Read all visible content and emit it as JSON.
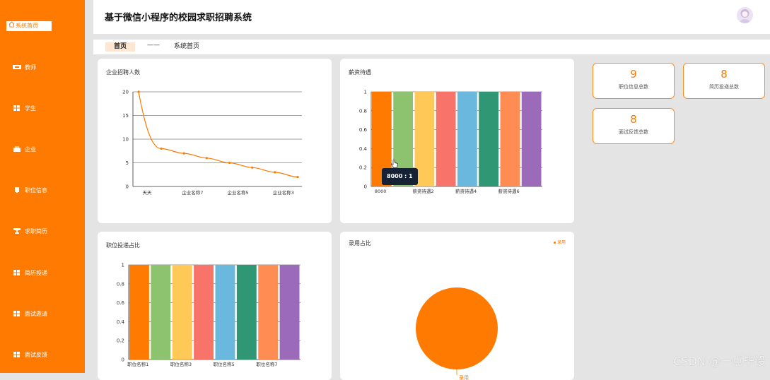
{
  "sidebar": {
    "home_label": "系统首页",
    "items": [
      {
        "label": "教师",
        "icon": "users-icon"
      },
      {
        "label": "学生",
        "icon": "grid-icon"
      },
      {
        "label": "企业",
        "icon": "briefcase-icon"
      },
      {
        "label": "职位信息",
        "icon": "device-icon"
      },
      {
        "label": "求职简历",
        "icon": "trophy-icon"
      },
      {
        "label": "简历投递",
        "icon": "grid-icon"
      },
      {
        "label": "面试邀请",
        "icon": "grid-icon"
      },
      {
        "label": "面试反馈",
        "icon": "grid-icon"
      }
    ]
  },
  "header": {
    "title": "基于微信小程序的校园求职招聘系统"
  },
  "breadcrumb": {
    "home": "首页",
    "separator": "——",
    "current": "系统首页"
  },
  "stats": [
    {
      "value": "9",
      "label": "职位信息总数"
    },
    {
      "value": "8",
      "label": "简历投递总数"
    },
    {
      "value": "8",
      "label": "面试反馈总数"
    }
  ],
  "colors": {
    "brand": "#ff7a00",
    "palette": [
      "#ff7a00",
      "#8dc26f",
      "#ffc857",
      "#f8736a",
      "#6ab8dd",
      "#2f9773",
      "#ff8c52",
      "#9b6ab8"
    ]
  },
  "charts": {
    "hiring": {
      "title": "企业招聘人数",
      "chart_data": {
        "type": "line",
        "categories": [
          "天天",
          "",
          "企业名称7",
          "",
          "企业名称5",
          "",
          "企业名称3",
          ""
        ],
        "values": [
          20,
          8,
          7,
          6,
          5,
          4,
          3,
          2
        ],
        "ylim": [
          0,
          20
        ],
        "yticks": [
          0,
          5,
          10,
          15,
          20
        ],
        "grid": true
      }
    },
    "salary": {
      "title": "薪资待遇",
      "chart_data": {
        "type": "bar",
        "categories": [
          "8000",
          "",
          "薪资待遇2",
          "",
          "薪资待遇4",
          "",
          "薪资待遇6",
          ""
        ],
        "values": [
          1,
          1,
          1,
          1,
          1,
          1,
          1,
          1
        ],
        "ylim": [
          0,
          1
        ],
        "yticks": [
          0,
          0.2,
          0.4,
          0.6,
          0.8,
          1
        ],
        "grid": true
      },
      "tooltip": "8000 : 1"
    },
    "applications": {
      "title": "职位投递占比",
      "chart_data": {
        "type": "bar",
        "categories": [
          "职位名称1",
          "",
          "职位名称3",
          "",
          "职位名称5",
          "",
          "职位名称7",
          ""
        ],
        "values": [
          1,
          1,
          1,
          1,
          1,
          1,
          1,
          1
        ],
        "ylim": [
          0,
          1
        ],
        "yticks": [
          0,
          0.2,
          0.4,
          0.6,
          0.8,
          1
        ],
        "grid": true
      }
    },
    "hire_ratio": {
      "title": "录用占比",
      "chart_data": {
        "type": "pie",
        "categories": [
          "录用"
        ],
        "values": [
          1
        ],
        "legend": "top-right"
      },
      "legend_label": "录用"
    }
  },
  "watermark": "CSDN @一点毕设"
}
